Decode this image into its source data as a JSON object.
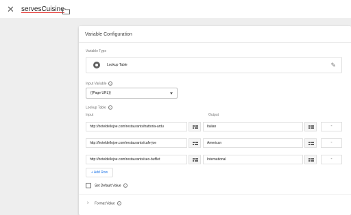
{
  "header": {
    "variable_name": "servesCuisine",
    "close_icon": "close-icon",
    "folder_icon": "folder-icon"
  },
  "config": {
    "title": "Variable Configuration",
    "variable_type_label": "Variable Type",
    "variable_type": "Lookup Table",
    "input_variable_label": "Input Variable",
    "input_variable_value": "{{Page URL}}",
    "lookup_table_label": "Lookup Table",
    "input_col": "Input",
    "output_col": "Output",
    "rows": [
      {
        "input": "http://hoteldellojoe.com/restaurants/trattoria-ardu",
        "output": "Italian"
      },
      {
        "input": "http://hoteldellojoe.com/restaurants/cafe-joe",
        "output": "American"
      },
      {
        "input": "http://hoteldellojoe.com/restaurants/seo-bufflet",
        "output": "International"
      }
    ],
    "remove_label": "-",
    "add_row_label": "+ Add Row",
    "set_default_label": "Set Default Value",
    "format_value_label": "Format Value",
    "help_glyph": "?"
  },
  "colors": {
    "accent": "#1a73e8",
    "underline": "#e53935"
  }
}
